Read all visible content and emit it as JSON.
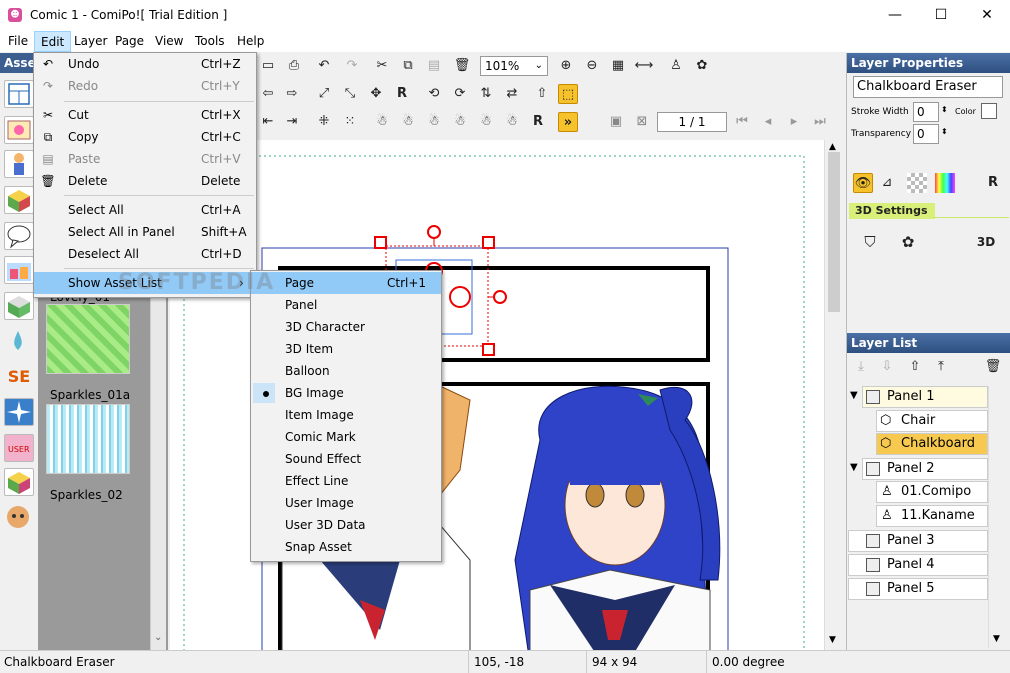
{
  "window": {
    "title": "Comic 1 - ComiPo![ Trial Edition ]",
    "app_icon": "comipo-app-icon"
  },
  "menubar": {
    "items": [
      "File",
      "Edit",
      "Layer",
      "Page",
      "View",
      "Tools",
      "Help"
    ],
    "active": "Edit"
  },
  "assets": {
    "title": "Assets",
    "items": [
      {
        "label": "Lovely_01"
      },
      {
        "label": "Sparkles_01a"
      },
      {
        "label": "Sparkles_02"
      }
    ]
  },
  "toolbar": {
    "zoom": "101%",
    "page": "1 / 1"
  },
  "edit_menu": {
    "items": [
      {
        "label": "Undo",
        "shortcut": "Ctrl+Z",
        "icon": "undo-icon",
        "disabled": false
      },
      {
        "label": "Redo",
        "shortcut": "Ctrl+Y",
        "icon": "redo-icon",
        "disabled": true
      },
      {
        "label": "Cut",
        "shortcut": "Ctrl+X",
        "icon": "scissors-icon",
        "disabled": false
      },
      {
        "label": "Copy",
        "shortcut": "Ctrl+C",
        "icon": "copy-icon",
        "disabled": false
      },
      {
        "label": "Paste",
        "shortcut": "Ctrl+V",
        "icon": "paste-icon",
        "disabled": true
      },
      {
        "label": "Delete",
        "shortcut": "Delete",
        "icon": "trash-icon",
        "disabled": false
      },
      {
        "label": "Select All",
        "shortcut": "Ctrl+A"
      },
      {
        "label": "Select All in Panel",
        "shortcut": "Shift+A"
      },
      {
        "label": "Deselect All",
        "shortcut": "Ctrl+D"
      },
      {
        "label": "Show Asset List",
        "shortcut": ""
      }
    ]
  },
  "submenu": {
    "items": [
      {
        "label": "Page",
        "shortcut": "Ctrl+1",
        "highlighted": true
      },
      {
        "label": "Panel"
      },
      {
        "label": "3D Character"
      },
      {
        "label": "3D Item"
      },
      {
        "label": "Balloon"
      },
      {
        "label": "BG Image",
        "selected": true
      },
      {
        "label": "Item Image"
      },
      {
        "label": "Comic Mark"
      },
      {
        "label": "Sound Effect"
      },
      {
        "label": "Effect Line"
      },
      {
        "label": "User Image"
      },
      {
        "label": "User 3D Data"
      },
      {
        "label": "Snap Asset"
      }
    ]
  },
  "watermark": "SOFTPEDIA",
  "layer_properties": {
    "title": "Layer Properties",
    "name": "Chalkboard Eraser",
    "stroke_width_label": "Stroke Width",
    "stroke_width": "0",
    "color_label": "Color",
    "transparency_label": "Transparency",
    "transparency": "0",
    "settings_label": "3D Settings"
  },
  "layer_list": {
    "title": "Layer List",
    "rows": [
      {
        "label": "Panel 1",
        "level": 0,
        "expanded": true
      },
      {
        "label": "Chair",
        "level": 1
      },
      {
        "label": "Chalkboard ...",
        "level": 1,
        "selected": true
      },
      {
        "label": "Panel 2",
        "level": 0,
        "expanded": true
      },
      {
        "label": "01.Comipo ...",
        "level": 1
      },
      {
        "label": "11.Kaname ...",
        "level": 1
      },
      {
        "label": "Panel 3",
        "level": 0
      },
      {
        "label": "Panel 4",
        "level": 0
      },
      {
        "label": "Panel 5",
        "level": 0
      }
    ]
  },
  "status": {
    "name": "Chalkboard Eraser",
    "coords": "105, -18",
    "size": "94 x 94",
    "angle": "0.00 degree"
  }
}
